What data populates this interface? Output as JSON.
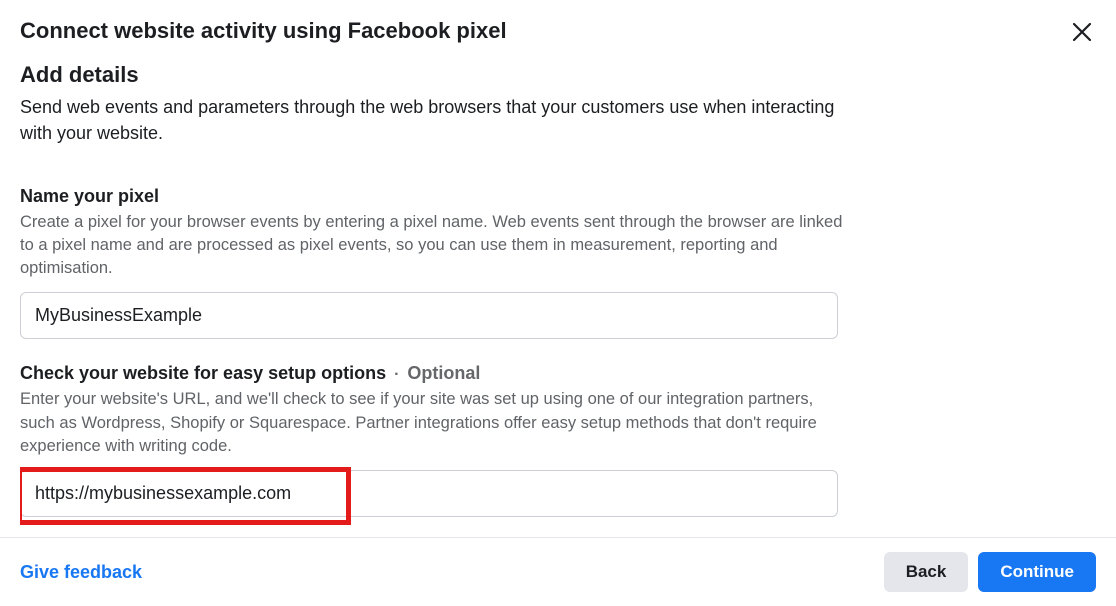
{
  "modal": {
    "title": "Connect website activity using Facebook pixel",
    "close_icon": "close-icon"
  },
  "details": {
    "heading": "Add details",
    "description": "Send web events and parameters through the web browsers that your customers use when interacting with your website."
  },
  "pixel_name": {
    "label": "Name your pixel",
    "help": "Create a pixel for your browser events by entering a pixel name. Web events sent through the browser are linked to a pixel name and are processed as pixel events, so you can use them in measurement, reporting and optimisation.",
    "value": "MyBusinessExample"
  },
  "website_check": {
    "label": "Check your website for easy setup options",
    "optional": "Optional",
    "help": "Enter your website's URL, and we'll check to see if your site was set up using one of our integration partners, such as Wordpress, Shopify or Squarespace. Partner integrations offer easy setup methods that don't require experience with writing code.",
    "value": "https://mybusinessexample.com"
  },
  "footer": {
    "feedback": "Give feedback",
    "back": "Back",
    "continue": "Continue"
  }
}
